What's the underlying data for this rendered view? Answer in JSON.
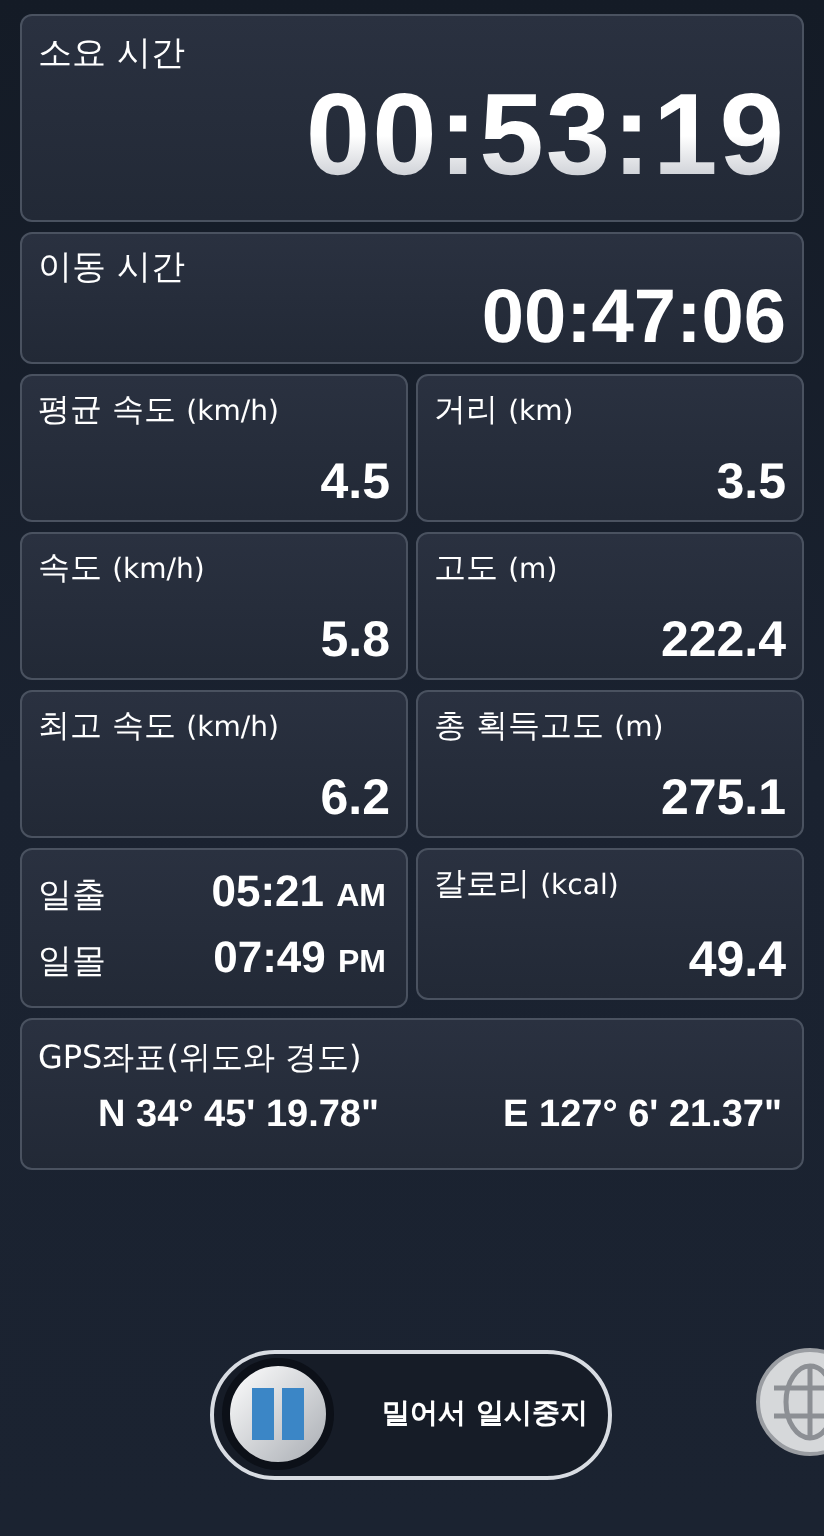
{
  "elapsed": {
    "label": "소요 시간",
    "value": "00:53:19"
  },
  "moving": {
    "label": "이동 시간",
    "value": "00:47:06"
  },
  "stats": [
    {
      "label": "평균 속도",
      "unit": "(km/h)",
      "value": "4.5"
    },
    {
      "label": "거리",
      "unit": "(km)",
      "value": "3.5"
    },
    {
      "label": "속도",
      "unit": "(km/h)",
      "value": "5.8"
    },
    {
      "label": "고도",
      "unit": "(m)",
      "value": "222.4"
    },
    {
      "label": "최고 속도",
      "unit": "(km/h)",
      "value": "6.2"
    },
    {
      "label": "총 획득고도",
      "unit": "(m)",
      "value": "275.1"
    }
  ],
  "sun": [
    {
      "label": "일출",
      "time": "05:21",
      "suffix": "AM"
    },
    {
      "label": "일몰",
      "time": "07:49",
      "suffix": "PM"
    }
  ],
  "calories": {
    "label": "칼로리",
    "unit": "(kcal)",
    "value": "49.4"
  },
  "gps": {
    "label": "GPS좌표(위도와 경도)",
    "latitude": "N 34° 45' 19.78\"",
    "longitude": "E 127° 6' 21.37\""
  },
  "slider": {
    "label": "밀어서 일시중지"
  }
}
